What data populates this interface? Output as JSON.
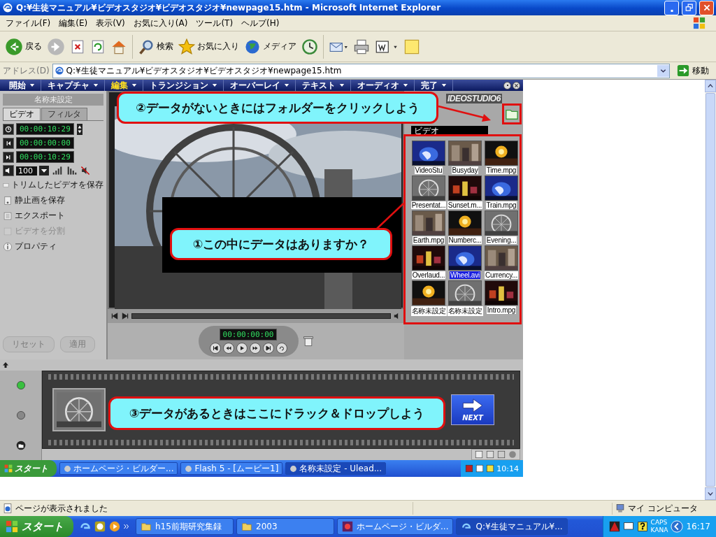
{
  "window": {
    "title": "Q:¥生徒マニュアル¥ビデオスタジオ¥ビデオスタジオ¥newpage15.htm - Microsoft Internet Explorer"
  },
  "menu_bar": [
    "ファイル(F)",
    "編集(E)",
    "表示(V)",
    "お気に入り(A)",
    "ツール(T)",
    "ヘルプ(H)"
  ],
  "toolbar": [
    {
      "kind": "back",
      "label": "戻る"
    },
    {
      "kind": "forward"
    },
    {
      "kind": "stop"
    },
    {
      "kind": "refresh"
    },
    {
      "kind": "home"
    },
    {
      "kind": "search",
      "label": "検索"
    },
    {
      "kind": "favorites",
      "label": "お気に入り"
    },
    {
      "kind": "media",
      "label": "メディア"
    },
    {
      "kind": "history"
    },
    {
      "kind": "mail"
    },
    {
      "kind": "print"
    },
    {
      "kind": "edit"
    },
    {
      "kind": "note"
    }
  ],
  "address_bar": {
    "label": "アドレス(D)",
    "value": "Q:¥生徒マニュアル¥ビデオスタジオ¥ビデオスタジオ¥newpage15.htm",
    "go_button": "移動"
  },
  "page": {
    "app_tabs": [
      {
        "label": "開始",
        "selected": false
      },
      {
        "label": "キャプチャ",
        "selected": false
      },
      {
        "label": "編集",
        "selected": true
      },
      {
        "label": "トランジション",
        "selected": false
      },
      {
        "label": "オーバーレイ",
        "selected": false
      },
      {
        "label": "テキスト",
        "selected": false
      },
      {
        "label": "オーディオ",
        "selected": false
      },
      {
        "label": "完了",
        "selected": false
      }
    ],
    "project_title": "名称未設定",
    "panel_tabs": [
      {
        "label": "ビデオ",
        "selected": true
      },
      {
        "label": "フィルタ",
        "selected": false
      }
    ],
    "timecodes": [
      "00:00:10:29",
      "00:00:00:00",
      "00:00:10:29"
    ],
    "volume": "100",
    "actions": [
      {
        "label": "トリムしたビデオを保存",
        "disabled": false
      },
      {
        "label": "静止画を保存",
        "disabled": false
      },
      {
        "label": "エクスポート",
        "disabled": false
      },
      {
        "label": "ビデオを分割",
        "disabled": true
      },
      {
        "label": "プロパティ",
        "disabled": false
      }
    ],
    "panel_buttons": [
      {
        "label": "リセット",
        "disabled": true
      },
      {
        "label": "適用",
        "disabled": true
      }
    ],
    "playback_timecode": "00:00:00:00",
    "logo": "IDEOSTUDIO6",
    "library": {
      "dropdown": "ビデオ",
      "clips": [
        {
          "name": "VideoStu",
          "selected": false
        },
        {
          "name": "Busyday",
          "selected": false
        },
        {
          "name": "Time.mpg",
          "selected": false
        },
        {
          "name": "Presentat...",
          "selected": false
        },
        {
          "name": "Sunset.m...",
          "selected": false
        },
        {
          "name": "Train.mpg",
          "selected": false
        },
        {
          "name": "Earth.mpg",
          "selected": false
        },
        {
          "name": "Numberc...",
          "selected": false
        },
        {
          "name": "Evening...",
          "selected": false
        },
        {
          "name": "Overlaud...",
          "selected": false
        },
        {
          "name": "Wheel.avi",
          "selected": true
        },
        {
          "name": "Currency...",
          "selected": false
        },
        {
          "name": "名称未設定",
          "selected": false
        },
        {
          "name": "名称未設定",
          "selected": false
        },
        {
          "name": "Intro.mpg",
          "selected": false
        }
      ]
    },
    "next_button": "NEXT",
    "callouts": [
      "②データがないときにはフォルダーをクリックしよう",
      "①この中にデータはありますか？",
      "③データがあるときはここにドラック＆ドロップしよう"
    ],
    "inner_taskbar": {
      "start": "スタート",
      "tasks": [
        {
          "label": "ホームページ・ビルダー...",
          "selected": false
        },
        {
          "label": "Flash 5 - [ムービー1]",
          "selected": false
        },
        {
          "label": "名称未設定 - Ulead...",
          "selected": true
        }
      ],
      "clock": "10:14"
    }
  },
  "status_bar": {
    "text": "ページが表示されました",
    "zone": "マイ コンピュータ"
  },
  "taskbar": {
    "start": "スタート",
    "tasks": [
      {
        "kind": "folder",
        "label": "h15前期研究集録",
        "selected": false
      },
      {
        "kind": "folder",
        "label": "2003",
        "selected": false
      },
      {
        "kind": "app",
        "label": "ホームページ・ビルダ...",
        "selected": false
      },
      {
        "kind": "browser",
        "label": "Q:¥生徒マニュアル¥...",
        "selected": true
      }
    ],
    "indicators": [
      "CAPS",
      "KANA"
    ],
    "clock": "16:17"
  }
}
